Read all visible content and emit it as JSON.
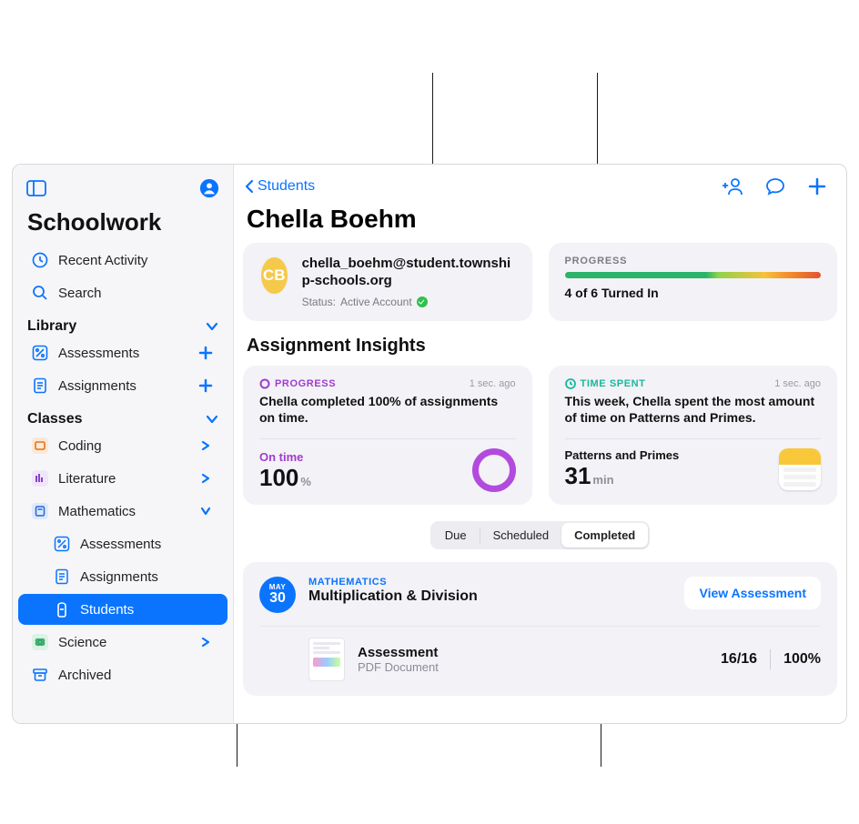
{
  "app": {
    "title": "Schoolwork"
  },
  "sidebar": {
    "recent": "Recent Activity",
    "search": "Search",
    "library_header": "Library",
    "assessments": "Assessments",
    "assignments": "Assignments",
    "classes_header": "Classes",
    "classes": {
      "coding": "Coding",
      "literature": "Literature",
      "mathematics": "Mathematics",
      "science": "Science"
    },
    "math_children": {
      "assessments": "Assessments",
      "assignments": "Assignments",
      "students": "Students"
    },
    "archived": "Archived"
  },
  "backlink": "Students",
  "student": {
    "name": "Chella Boehm",
    "initials": "CB",
    "email": "chella_boehm@student.township-schools.org",
    "status_prefix": "Status: ",
    "status": "Active Account"
  },
  "progress_card": {
    "label": "PROGRESS",
    "text": "4 of 6 Turned In"
  },
  "insights_header": "Assignment Insights",
  "insight_progress": {
    "badge": "PROGRESS",
    "time": "1 sec. ago",
    "headline": "Chella completed 100% of assignments on time.",
    "metric_label": "On time",
    "metric_value": "100",
    "metric_unit": "%"
  },
  "insight_time": {
    "badge": "TIME SPENT",
    "time": "1 sec. ago",
    "headline": "This week, Chella spent the most amount of time on Patterns and Primes.",
    "metric_label": "Patterns and Primes",
    "metric_value": "31",
    "metric_unit": "min"
  },
  "segmented": {
    "due": "Due",
    "scheduled": "Scheduled",
    "completed": "Completed"
  },
  "assignment": {
    "month": "MAY",
    "day": "30",
    "subject": "MATHEMATICS",
    "title": "Multiplication & Division",
    "view_btn": "View Assessment",
    "doc_name": "Assessment",
    "doc_type": "PDF Document",
    "score": "16/16",
    "percent": "100%"
  }
}
